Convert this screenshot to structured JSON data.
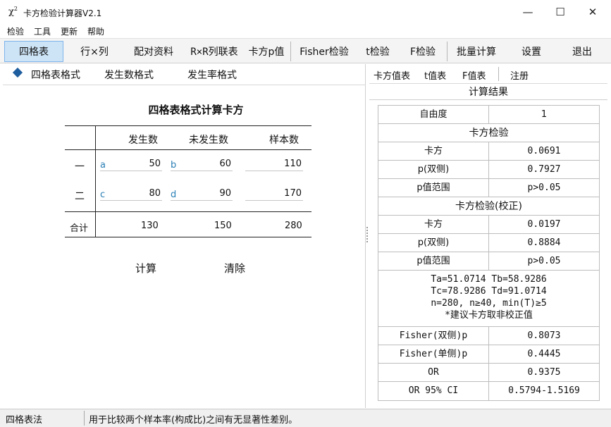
{
  "window": {
    "icon_text": "χ²",
    "title": "卡方检验计算器V2.1",
    "minimize": "—",
    "maximize": "☐",
    "close": "✕"
  },
  "menu": [
    "检验",
    "工具",
    "更新",
    "帮助"
  ],
  "toolbar": {
    "items": [
      "四格表",
      "行×列",
      "配对资料",
      "R×R列联表",
      "卡方p值",
      "Fisher检验",
      "t检验",
      "F检验",
      "批量计算",
      "设置",
      "退出"
    ],
    "active": "四格表"
  },
  "left_tabs": [
    "四格表格式",
    "发生数格式",
    "发生率格式"
  ],
  "calc": {
    "title": "四格表格式计算卡方",
    "headers": [
      "发生数",
      "未发生数",
      "样本数"
    ],
    "rows": [
      {
        "label": "一",
        "cells": [
          {
            "letter": "a",
            "value": "50"
          },
          {
            "letter": "b",
            "value": "60"
          },
          {
            "letter": "",
            "value": "110"
          }
        ]
      },
      {
        "label": "二",
        "cells": [
          {
            "letter": "c",
            "value": "80"
          },
          {
            "letter": "d",
            "value": "90"
          },
          {
            "letter": "",
            "value": "170"
          }
        ]
      }
    ],
    "total": {
      "label": "合计",
      "values": [
        "130",
        "150",
        "280"
      ]
    },
    "calc_button": "计算",
    "clear_button": "清除"
  },
  "right_tabs": [
    "卡方值表",
    "t值表",
    "F值表",
    "注册"
  ],
  "results": {
    "title": "计算结果",
    "df": {
      "label": "自由度",
      "value": "1"
    },
    "section1": "卡方检验",
    "chi1": [
      {
        "label": "卡方",
        "value": "0.0691"
      },
      {
        "label": "p(双侧)",
        "value": "0.7927"
      },
      {
        "label": "p值范围",
        "value": "p>0.05"
      }
    ],
    "section2": "卡方检验(校正)",
    "chi2": [
      {
        "label": "卡方",
        "value": "0.0197"
      },
      {
        "label": "p(双侧)",
        "value": "0.8884"
      },
      {
        "label": "p值范围",
        "value": "p>0.05"
      }
    ],
    "note": [
      "Ta=51.0714   Tb=58.9286",
      "Tc=78.9286   Td=91.0714",
      "n=280, n≥40, min(T)≥5",
      "*建议卡方取非校正值"
    ],
    "extra": [
      {
        "label": "Fisher(双侧)p",
        "value": "0.8073"
      },
      {
        "label": "Fisher(单侧)p",
        "value": "0.4445"
      },
      {
        "label": "OR",
        "value": "0.9375"
      },
      {
        "label": "OR 95% CI",
        "value": "0.5794-1.5169"
      }
    ]
  },
  "status": {
    "left": "四格表法",
    "message": "用于比较两个样本率(构成比)之间有无显著性差别。"
  }
}
